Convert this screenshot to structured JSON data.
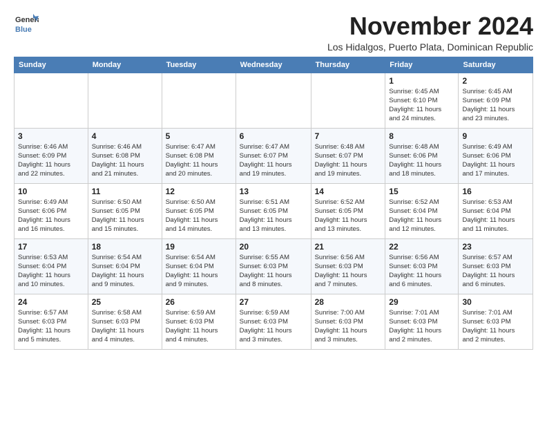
{
  "logo": {
    "line1": "General",
    "line2": "Blue"
  },
  "title": "November 2024",
  "location": "Los Hidalgos, Puerto Plata, Dominican Republic",
  "days_of_week": [
    "Sunday",
    "Monday",
    "Tuesday",
    "Wednesday",
    "Thursday",
    "Friday",
    "Saturday"
  ],
  "weeks": [
    [
      {
        "num": "",
        "info": ""
      },
      {
        "num": "",
        "info": ""
      },
      {
        "num": "",
        "info": ""
      },
      {
        "num": "",
        "info": ""
      },
      {
        "num": "",
        "info": ""
      },
      {
        "num": "1",
        "info": "Sunrise: 6:45 AM\nSunset: 6:10 PM\nDaylight: 11 hours\nand 24 minutes."
      },
      {
        "num": "2",
        "info": "Sunrise: 6:45 AM\nSunset: 6:09 PM\nDaylight: 11 hours\nand 23 minutes."
      }
    ],
    [
      {
        "num": "3",
        "info": "Sunrise: 6:46 AM\nSunset: 6:09 PM\nDaylight: 11 hours\nand 22 minutes."
      },
      {
        "num": "4",
        "info": "Sunrise: 6:46 AM\nSunset: 6:08 PM\nDaylight: 11 hours\nand 21 minutes."
      },
      {
        "num": "5",
        "info": "Sunrise: 6:47 AM\nSunset: 6:08 PM\nDaylight: 11 hours\nand 20 minutes."
      },
      {
        "num": "6",
        "info": "Sunrise: 6:47 AM\nSunset: 6:07 PM\nDaylight: 11 hours\nand 19 minutes."
      },
      {
        "num": "7",
        "info": "Sunrise: 6:48 AM\nSunset: 6:07 PM\nDaylight: 11 hours\nand 19 minutes."
      },
      {
        "num": "8",
        "info": "Sunrise: 6:48 AM\nSunset: 6:06 PM\nDaylight: 11 hours\nand 18 minutes."
      },
      {
        "num": "9",
        "info": "Sunrise: 6:49 AM\nSunset: 6:06 PM\nDaylight: 11 hours\nand 17 minutes."
      }
    ],
    [
      {
        "num": "10",
        "info": "Sunrise: 6:49 AM\nSunset: 6:06 PM\nDaylight: 11 hours\nand 16 minutes."
      },
      {
        "num": "11",
        "info": "Sunrise: 6:50 AM\nSunset: 6:05 PM\nDaylight: 11 hours\nand 15 minutes."
      },
      {
        "num": "12",
        "info": "Sunrise: 6:50 AM\nSunset: 6:05 PM\nDaylight: 11 hours\nand 14 minutes."
      },
      {
        "num": "13",
        "info": "Sunrise: 6:51 AM\nSunset: 6:05 PM\nDaylight: 11 hours\nand 13 minutes."
      },
      {
        "num": "14",
        "info": "Sunrise: 6:52 AM\nSunset: 6:05 PM\nDaylight: 11 hours\nand 13 minutes."
      },
      {
        "num": "15",
        "info": "Sunrise: 6:52 AM\nSunset: 6:04 PM\nDaylight: 11 hours\nand 12 minutes."
      },
      {
        "num": "16",
        "info": "Sunrise: 6:53 AM\nSunset: 6:04 PM\nDaylight: 11 hours\nand 11 minutes."
      }
    ],
    [
      {
        "num": "17",
        "info": "Sunrise: 6:53 AM\nSunset: 6:04 PM\nDaylight: 11 hours\nand 10 minutes."
      },
      {
        "num": "18",
        "info": "Sunrise: 6:54 AM\nSunset: 6:04 PM\nDaylight: 11 hours\nand 9 minutes."
      },
      {
        "num": "19",
        "info": "Sunrise: 6:54 AM\nSunset: 6:04 PM\nDaylight: 11 hours\nand 9 minutes."
      },
      {
        "num": "20",
        "info": "Sunrise: 6:55 AM\nSunset: 6:03 PM\nDaylight: 11 hours\nand 8 minutes."
      },
      {
        "num": "21",
        "info": "Sunrise: 6:56 AM\nSunset: 6:03 PM\nDaylight: 11 hours\nand 7 minutes."
      },
      {
        "num": "22",
        "info": "Sunrise: 6:56 AM\nSunset: 6:03 PM\nDaylight: 11 hours\nand 6 minutes."
      },
      {
        "num": "23",
        "info": "Sunrise: 6:57 AM\nSunset: 6:03 PM\nDaylight: 11 hours\nand 6 minutes."
      }
    ],
    [
      {
        "num": "24",
        "info": "Sunrise: 6:57 AM\nSunset: 6:03 PM\nDaylight: 11 hours\nand 5 minutes."
      },
      {
        "num": "25",
        "info": "Sunrise: 6:58 AM\nSunset: 6:03 PM\nDaylight: 11 hours\nand 4 minutes."
      },
      {
        "num": "26",
        "info": "Sunrise: 6:59 AM\nSunset: 6:03 PM\nDaylight: 11 hours\nand 4 minutes."
      },
      {
        "num": "27",
        "info": "Sunrise: 6:59 AM\nSunset: 6:03 PM\nDaylight: 11 hours\nand 3 minutes."
      },
      {
        "num": "28",
        "info": "Sunrise: 7:00 AM\nSunset: 6:03 PM\nDaylight: 11 hours\nand 3 minutes."
      },
      {
        "num": "29",
        "info": "Sunrise: 7:01 AM\nSunset: 6:03 PM\nDaylight: 11 hours\nand 2 minutes."
      },
      {
        "num": "30",
        "info": "Sunrise: 7:01 AM\nSunset: 6:03 PM\nDaylight: 11 hours\nand 2 minutes."
      }
    ]
  ]
}
